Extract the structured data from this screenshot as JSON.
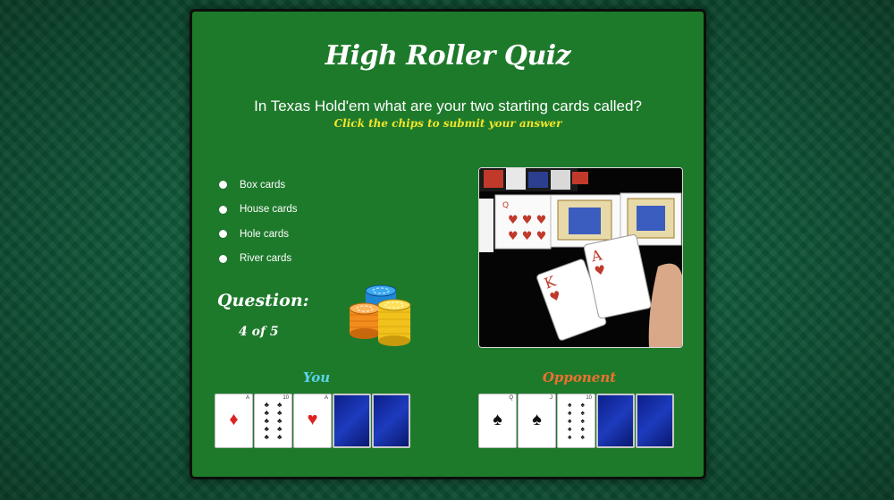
{
  "title": "High Roller Quiz",
  "question_text": "In Texas Hold'em what are your two starting cards called?",
  "hint_text": "Click the chips to submit your answer",
  "options": [
    {
      "label": "Box cards"
    },
    {
      "label": "House cards"
    },
    {
      "label": "Hole cards"
    },
    {
      "label": "River cards"
    }
  ],
  "progress": {
    "label": "Question:",
    "count": "4 of 5"
  },
  "players": {
    "you": {
      "label": "You",
      "label_color": "#5ad3ea",
      "cards": [
        {
          "rank": "A",
          "suit": "diamonds",
          "face": "up"
        },
        {
          "rank": "10",
          "suit": "clubs",
          "face": "up"
        },
        {
          "rank": "A",
          "suit": "hearts",
          "face": "up"
        },
        {
          "face": "down"
        },
        {
          "face": "down"
        }
      ]
    },
    "opponent": {
      "label": "Opponent",
      "label_color": "#f07030",
      "cards": [
        {
          "rank": "Q",
          "suit": "spades",
          "face": "up"
        },
        {
          "rank": "J",
          "suit": "spades",
          "face": "up"
        },
        {
          "rank": "10",
          "suit": "spades",
          "face": "up"
        },
        {
          "face": "down"
        },
        {
          "face": "down"
        }
      ]
    }
  },
  "colors": {
    "table_felt": "#1e7a2b",
    "hint": "#f2e52a"
  },
  "icons": [
    "chip-stack-icon",
    "radio-icon",
    "card-back-icon"
  ]
}
